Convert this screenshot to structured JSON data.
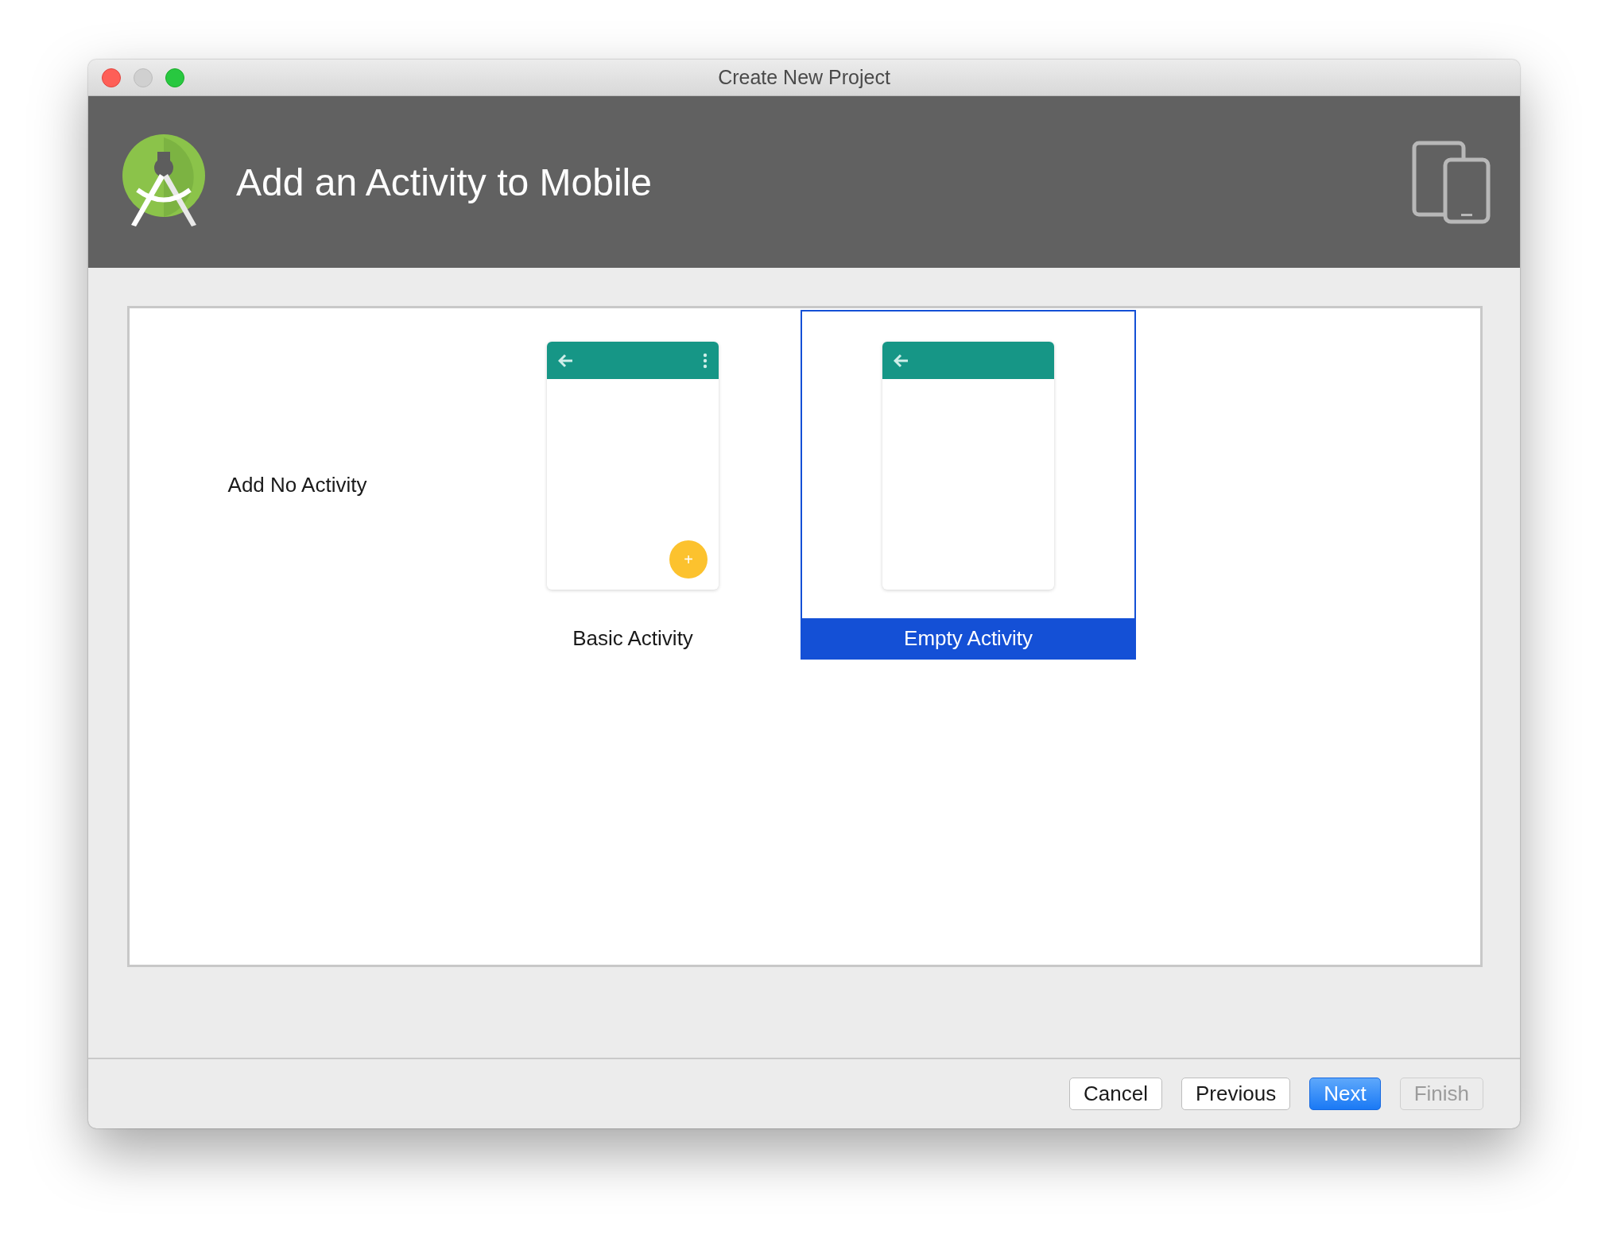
{
  "window": {
    "title": "Create New Project"
  },
  "header": {
    "title": "Add an Activity to Mobile"
  },
  "templates": [
    {
      "kind": "none",
      "label": "Add No Activity",
      "selected": false
    },
    {
      "kind": "basic",
      "label": "Basic Activity",
      "selected": false,
      "fab": "+"
    },
    {
      "kind": "empty",
      "label": "Empty Activity",
      "selected": true
    }
  ],
  "buttons": [
    {
      "label": "Cancel",
      "kind": "normal",
      "disabled": false
    },
    {
      "label": "Previous",
      "kind": "normal",
      "disabled": false
    },
    {
      "label": "Next",
      "kind": "default",
      "disabled": false
    },
    {
      "label": "Finish",
      "kind": "normal",
      "disabled": true
    }
  ]
}
